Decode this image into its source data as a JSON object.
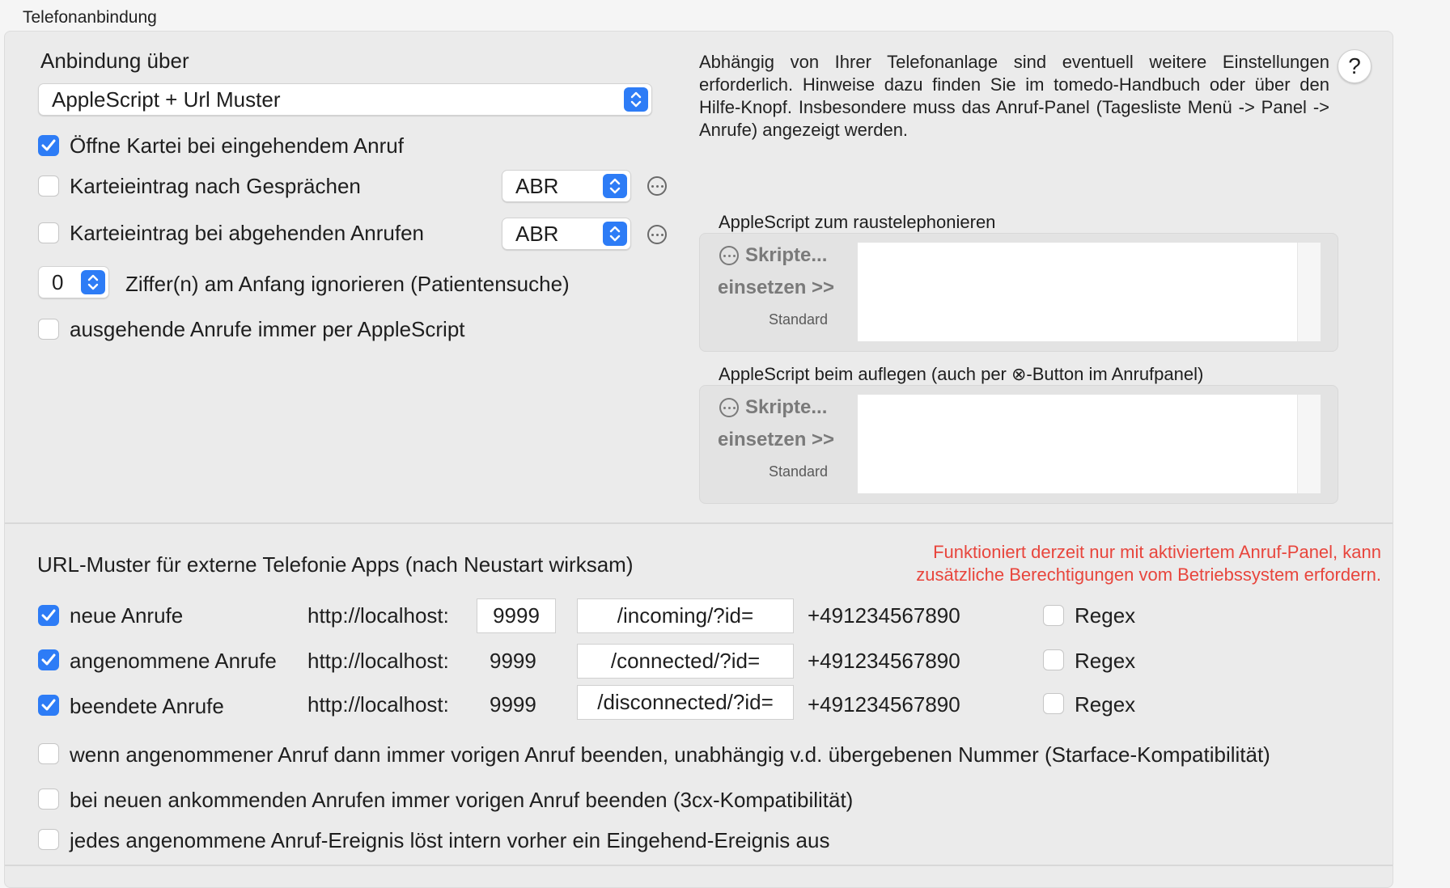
{
  "section_title": "Telefonanbindung",
  "connection": {
    "label": "Anbindung über",
    "selected": "AppleScript + Url Muster"
  },
  "options": {
    "open_card": {
      "label": "Öffne Kartei bei eingehendem Anruf",
      "checked": true
    },
    "entry_after_calls": {
      "label": "Karteieintrag nach Gesprächen",
      "checked": false,
      "type_value": "ABR"
    },
    "entry_outgoing": {
      "label": "Karteieintrag bei abgehenden Anrufen",
      "checked": false,
      "type_value": "ABR"
    },
    "ignore_digits": {
      "value": "0",
      "label": "Ziffer(n) am Anfang ignorieren (Patientensuche)"
    },
    "outgoing_applescript": {
      "label": "ausgehende Anrufe immer per AppleScript",
      "checked": false
    }
  },
  "help_button_label": "?",
  "info_text": "Abhängig von Ihrer Telefonanlage sind eventuell weitere Einstellungen erforderlich. Hinweise dazu finden Sie im tomedo-Handbuch oder über den Hilfe-Knopf. Insbesondere muss das Anruf-Panel (Tagesliste Menü -> Panel -> Anrufe) angezeigt werden.",
  "script_dial": {
    "title": "AppleScript zum raustelephonieren",
    "scripts_label": "Skripte...",
    "insert_label": "einsetzen >>",
    "standard_label": "Standard",
    "content": ""
  },
  "script_hangup": {
    "title": "AppleScript beim auflegen (auch per ⊗-Button im Anrufpanel)",
    "scripts_label": "Skripte...",
    "insert_label": "einsetzen >>",
    "standard_label": "Standard",
    "content": ""
  },
  "url_section": {
    "title": "URL-Muster für externe Telefonie Apps (nach Neustart wirksam)",
    "warning_line1": "Funktioniert derzeit nur mit aktiviertem Anruf-Panel, kann",
    "warning_line2": "zusätzliche Berechtigungen vom Betriebssystem erfordern.",
    "rows": [
      {
        "label": "neue Anrufe",
        "checked": true,
        "prefix": "http://localhost:",
        "port": "9999",
        "path": "/incoming/?id=",
        "example": "+491234567890",
        "regex_label": "Regex",
        "regex": false
      },
      {
        "label": "angenommene Anrufe",
        "checked": true,
        "prefix": "http://localhost:",
        "port": "9999",
        "path": "/connected/?id=",
        "example": "+491234567890",
        "regex_label": "Regex",
        "regex": false
      },
      {
        "label": "beendete Anrufe",
        "checked": true,
        "prefix": "http://localhost:",
        "port": "9999",
        "path": "/disconnected/?id=",
        "example": "+491234567890",
        "regex_label": "Regex",
        "regex": false
      }
    ],
    "compat": [
      {
        "label": "wenn angenommener Anruf dann immer vorigen Anruf beenden, unabhängig v.d. übergebenen Nummer (Starface-Kompatibilität)",
        "checked": false
      },
      {
        "label": "bei neuen ankommenden Anrufen immer vorigen Anruf beenden (3cx-Kompatibilität)",
        "checked": false
      },
      {
        "label": "jedes angenommene Anruf-Ereignis löst intern vorher ein Eingehend-Ereignis aus",
        "checked": false
      }
    ]
  },
  "colors": {
    "accent": "#2d7cf6",
    "warning": "#e8453c",
    "panel": "#ebebeb"
  }
}
